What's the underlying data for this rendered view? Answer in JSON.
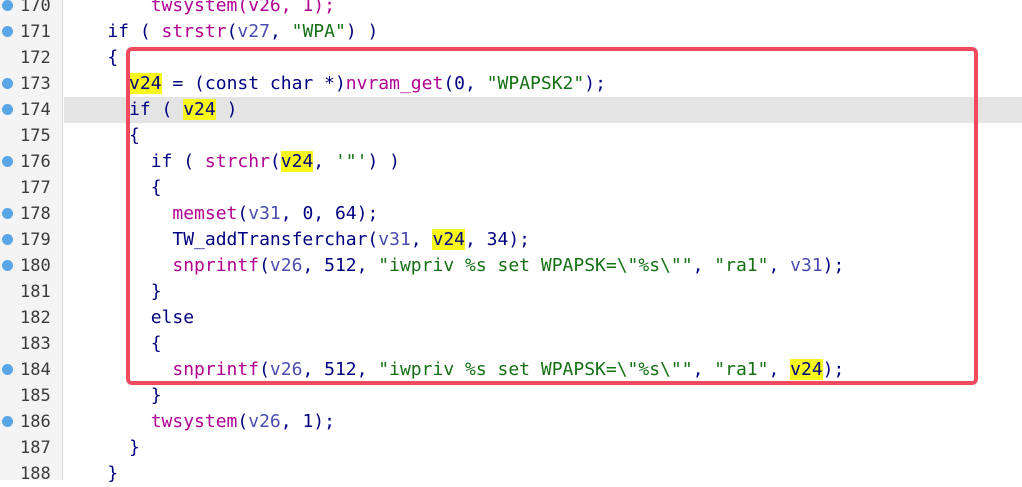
{
  "editor": {
    "lines": [
      {
        "num": "170",
        "bp": true,
        "current": false,
        "tokens": [
          {
            "t": "        twsystem(v26, 1);",
            "c": "call"
          }
        ]
      },
      {
        "num": "171",
        "bp": true,
        "current": false,
        "tokens": [
          {
            "t": "    if ( ",
            "c": "plain"
          },
          {
            "t": "strstr",
            "c": "call"
          },
          {
            "t": "(",
            "c": "plain"
          },
          {
            "t": "v27",
            "c": "var"
          },
          {
            "t": ", ",
            "c": "plain"
          },
          {
            "t": "\"WPA\"",
            "c": "str"
          },
          {
            "t": ") )",
            "c": "plain"
          }
        ]
      },
      {
        "num": "172",
        "bp": false,
        "current": false,
        "tokens": [
          {
            "t": "    {",
            "c": "plain"
          }
        ]
      },
      {
        "num": "173",
        "bp": true,
        "current": false,
        "tokens": [
          {
            "t": "      ",
            "c": "plain"
          },
          {
            "t": "v24",
            "c": "hl"
          },
          {
            "t": " = (const char *)",
            "c": "plain"
          },
          {
            "t": "nvram_get",
            "c": "call"
          },
          {
            "t": "(0, ",
            "c": "plain"
          },
          {
            "t": "\"WPAPSK2\"",
            "c": "str"
          },
          {
            "t": ");",
            "c": "plain"
          }
        ]
      },
      {
        "num": "174",
        "bp": true,
        "current": true,
        "tokens": [
          {
            "t": "      if ( ",
            "c": "plain"
          },
          {
            "t": "v24",
            "c": "hl"
          },
          {
            "t": " )",
            "c": "plain"
          }
        ]
      },
      {
        "num": "175",
        "bp": false,
        "current": false,
        "tokens": [
          {
            "t": "      {",
            "c": "plain"
          }
        ]
      },
      {
        "num": "176",
        "bp": true,
        "current": false,
        "tokens": [
          {
            "t": "        if ( ",
            "c": "plain"
          },
          {
            "t": "strchr",
            "c": "call"
          },
          {
            "t": "(",
            "c": "plain"
          },
          {
            "t": "v24",
            "c": "hl"
          },
          {
            "t": ", ",
            "c": "plain"
          },
          {
            "t": "'\"'",
            "c": "str"
          },
          {
            "t": ") )",
            "c": "plain"
          }
        ]
      },
      {
        "num": "177",
        "bp": false,
        "current": false,
        "tokens": [
          {
            "t": "        {",
            "c": "plain"
          }
        ]
      },
      {
        "num": "178",
        "bp": true,
        "current": false,
        "tokens": [
          {
            "t": "          ",
            "c": "plain"
          },
          {
            "t": "memset",
            "c": "call"
          },
          {
            "t": "(",
            "c": "plain"
          },
          {
            "t": "v31",
            "c": "var"
          },
          {
            "t": ", 0, 64);",
            "c": "plain"
          }
        ]
      },
      {
        "num": "179",
        "bp": true,
        "current": false,
        "tokens": [
          {
            "t": "          TW_addTransferchar(",
            "c": "plain"
          },
          {
            "t": "v31",
            "c": "var"
          },
          {
            "t": ", ",
            "c": "plain"
          },
          {
            "t": "v24",
            "c": "hl"
          },
          {
            "t": ", 34);",
            "c": "plain"
          }
        ]
      },
      {
        "num": "180",
        "bp": true,
        "current": false,
        "tokens": [
          {
            "t": "          ",
            "c": "plain"
          },
          {
            "t": "snprintf",
            "c": "call"
          },
          {
            "t": "(",
            "c": "plain"
          },
          {
            "t": "v26",
            "c": "var"
          },
          {
            "t": ", 512, ",
            "c": "plain"
          },
          {
            "t": "\"iwpriv %s set WPAPSK=\\\"%s\\\"\"",
            "c": "str"
          },
          {
            "t": ", ",
            "c": "plain"
          },
          {
            "t": "\"ra1\"",
            "c": "str"
          },
          {
            "t": ", ",
            "c": "plain"
          },
          {
            "t": "v31",
            "c": "var"
          },
          {
            "t": ");",
            "c": "plain"
          }
        ]
      },
      {
        "num": "181",
        "bp": false,
        "current": false,
        "tokens": [
          {
            "t": "        }",
            "c": "plain"
          }
        ]
      },
      {
        "num": "182",
        "bp": false,
        "current": false,
        "tokens": [
          {
            "t": "        else",
            "c": "plain"
          }
        ]
      },
      {
        "num": "183",
        "bp": false,
        "current": false,
        "tokens": [
          {
            "t": "        {",
            "c": "plain"
          }
        ]
      },
      {
        "num": "184",
        "bp": true,
        "current": false,
        "tokens": [
          {
            "t": "          ",
            "c": "plain"
          },
          {
            "t": "snprintf",
            "c": "call"
          },
          {
            "t": "(",
            "c": "plain"
          },
          {
            "t": "v26",
            "c": "var"
          },
          {
            "t": ", 512, ",
            "c": "plain"
          },
          {
            "t": "\"iwpriv %s set WPAPSK=\\\"%s\\\"\"",
            "c": "str"
          },
          {
            "t": ", ",
            "c": "plain"
          },
          {
            "t": "\"ra1\"",
            "c": "str"
          },
          {
            "t": ", ",
            "c": "plain"
          },
          {
            "t": "v24",
            "c": "hl"
          },
          {
            "t": ");",
            "c": "plain"
          }
        ]
      },
      {
        "num": "185",
        "bp": false,
        "current": false,
        "tokens": [
          {
            "t": "        }",
            "c": "plain"
          }
        ]
      },
      {
        "num": "186",
        "bp": true,
        "current": false,
        "tokens": [
          {
            "t": "        ",
            "c": "plain"
          },
          {
            "t": "twsystem",
            "c": "call"
          },
          {
            "t": "(",
            "c": "plain"
          },
          {
            "t": "v26",
            "c": "var"
          },
          {
            "t": ", 1);",
            "c": "plain"
          }
        ]
      },
      {
        "num": "187",
        "bp": false,
        "current": false,
        "tokens": [
          {
            "t": "      }",
            "c": "plain"
          }
        ]
      },
      {
        "num": "188",
        "bp": false,
        "current": false,
        "tokens": [
          {
            "t": "    }",
            "c": "plain"
          }
        ]
      }
    ]
  },
  "colors": {
    "highlight_box": "#f04a5f",
    "identifier_highlight": "#f7f71a",
    "breakpoint": "#5aa6e6",
    "current_line": "#e4e4e4"
  }
}
